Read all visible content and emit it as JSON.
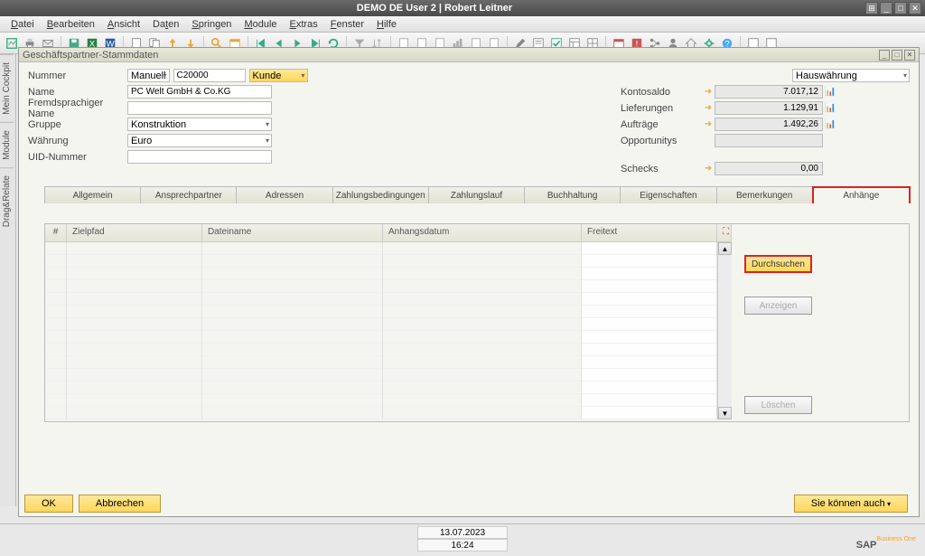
{
  "titlebar": {
    "title": "DEMO DE User 2 | Robert Leitner"
  },
  "menu": {
    "items": [
      "Datei",
      "Bearbeiten",
      "Ansicht",
      "Daten",
      "Springen",
      "Module",
      "Extras",
      "Fenster",
      "Hilfe"
    ]
  },
  "sidebar": {
    "tabs": [
      "Mein Cockpit",
      "Module",
      "Drag&Relate"
    ]
  },
  "window": {
    "title": "Geschäftspartner-Stammdaten",
    "fields": {
      "nummer_label": "Nummer",
      "nummer_type": "Manuell",
      "nummer_value": "C20000",
      "typ": "Kunde",
      "name_label": "Name",
      "name_value": "PC Welt GmbH & Co.KG",
      "fremd_label": "Fremdsprachiger Name",
      "fremd_value": "",
      "gruppe_label": "Gruppe",
      "gruppe_value": "Konstruktion",
      "waehrung_label": "Währung",
      "waehrung_value": "Euro",
      "uid_label": "UID-Nummer",
      "uid_value": ""
    },
    "right": {
      "currency": "Hauswährung",
      "konto_label": "Kontosaldo",
      "konto_value": "7.017,12",
      "lief_label": "Lieferungen",
      "lief_value": "1.129,91",
      "auf_label": "Aufträge",
      "auf_value": "1.492,26",
      "opp_label": "Opportunitys",
      "opp_value": "",
      "schecks_label": "Schecks",
      "schecks_value": "0,00"
    },
    "tabs": [
      "Allgemein",
      "Ansprechpartner",
      "Adressen",
      "Zahlungsbedingungen",
      "Zahlungslauf",
      "Buchhaltung",
      "Eigenschaften",
      "Bemerkungen",
      "Anhänge"
    ],
    "table": {
      "headers": {
        "num": "#",
        "zielpfad": "Zielpfad",
        "dateiname": "Dateiname",
        "anhangsdatum": "Anhangsdatum",
        "freitext": "Freitext"
      }
    },
    "actions": {
      "durchsuchen": "Durchsuchen",
      "anzeigen": "Anzeigen",
      "loeschen": "Löschen"
    },
    "buttons": {
      "ok": "OK",
      "abbrechen": "Abbrechen",
      "koennen": "Sie können auch"
    }
  },
  "status": {
    "date": "13.07.2023",
    "time": "16:24"
  },
  "logo": {
    "text": "SAP",
    "sub": "Business One"
  }
}
